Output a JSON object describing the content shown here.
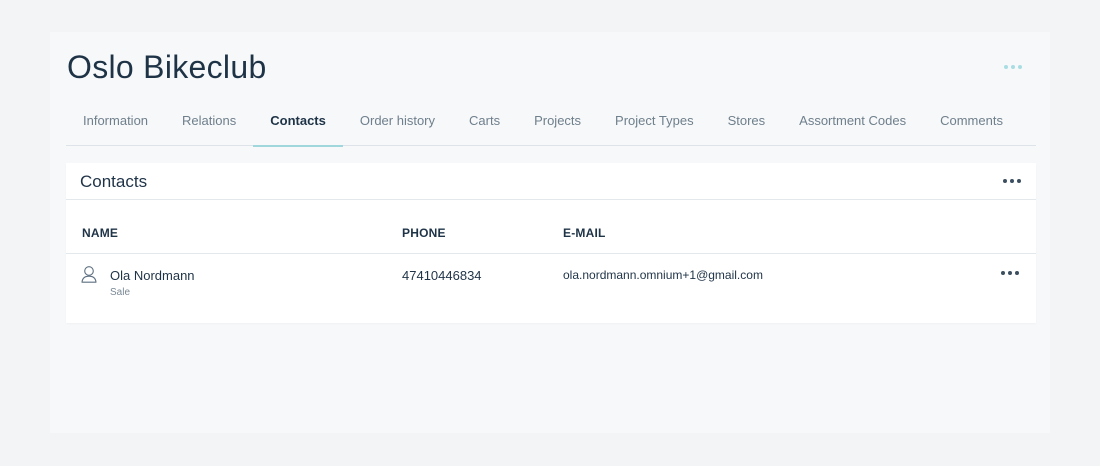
{
  "page": {
    "title": "Oslo Bikeclub"
  },
  "tabs": [
    {
      "label": "Information"
    },
    {
      "label": "Relations"
    },
    {
      "label": "Contacts",
      "active": true
    },
    {
      "label": "Order history"
    },
    {
      "label": "Carts"
    },
    {
      "label": "Projects"
    },
    {
      "label": "Project Types"
    },
    {
      "label": "Stores"
    },
    {
      "label": "Assortment Codes"
    },
    {
      "label": "Comments"
    }
  ],
  "contacts_card": {
    "title": "Contacts",
    "columns": {
      "name": "NAME",
      "phone": "PHONE",
      "email": "E-MAIL"
    },
    "rows": [
      {
        "name": "Ola Nordmann",
        "role": "Sale",
        "phone": "47410446834",
        "email": "ola.nordmann.omnium+1@gmail.com",
        "icon": "person-icon"
      }
    ]
  },
  "colors": {
    "accent": "#9fd7dc",
    "text": "#1f3347",
    "muted": "#6f7f8c"
  },
  "icons": {
    "header_menu": "more-horizontal-icon",
    "card_menu": "more-horizontal-icon",
    "row_menu": "more-horizontal-icon"
  }
}
